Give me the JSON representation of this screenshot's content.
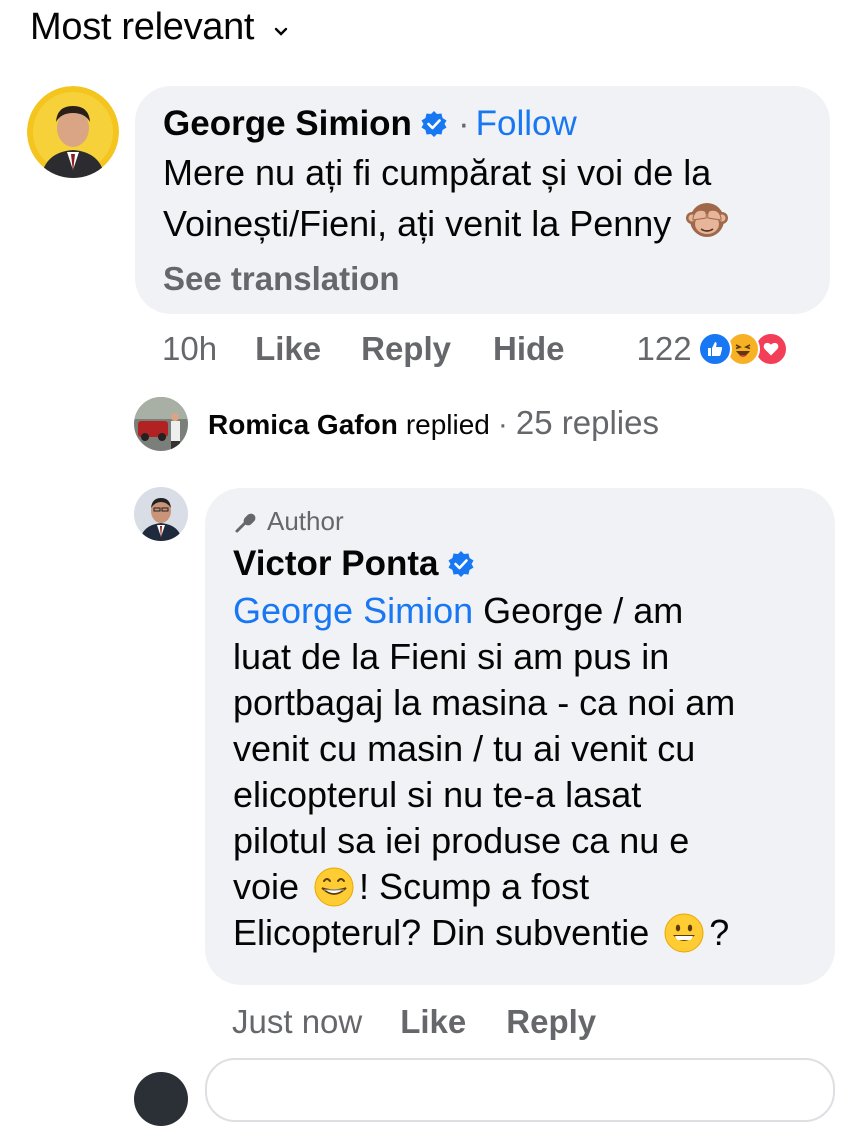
{
  "sort": {
    "label": "Most relevant"
  },
  "comment": {
    "author": "George Simion",
    "follow_label": "Follow",
    "separator": "·",
    "text_line1": "Mere nu ați fi cumpărat și voi de la",
    "text_line2": "Voinești/Fieni, ați venit la Penny",
    "emoji": "see-no-evil-monkey",
    "see_translation": "See translation",
    "time": "10h",
    "like": "Like",
    "reply": "Reply",
    "hide": "Hide",
    "reaction_count": "122",
    "reactions": [
      "like",
      "haha",
      "love"
    ]
  },
  "replies_summary": {
    "name": "Romica Gafon",
    "replied": "replied",
    "separator": "·",
    "count": "25 replies"
  },
  "reply": {
    "badge": "Author",
    "author": "Victor Ponta",
    "mention": "George Simion",
    "lines": [
      "George / am",
      "luat de la Fieni si am pus in",
      "portbagaj la masina - ca noi am",
      "venit cu masin / tu ai venit cu",
      "elicopterul si nu te-a lasat",
      "pilotul sa iei produse ca nu e",
      "voie",
      "! Scump a fost",
      "Elicopterul? Din subventie",
      "?"
    ],
    "time": "Just now",
    "like": "Like",
    "reply": "Reply"
  },
  "colors": {
    "accent": "#1877f2",
    "bubble": "#f0f2f5",
    "secondary_text": "#65676b"
  }
}
